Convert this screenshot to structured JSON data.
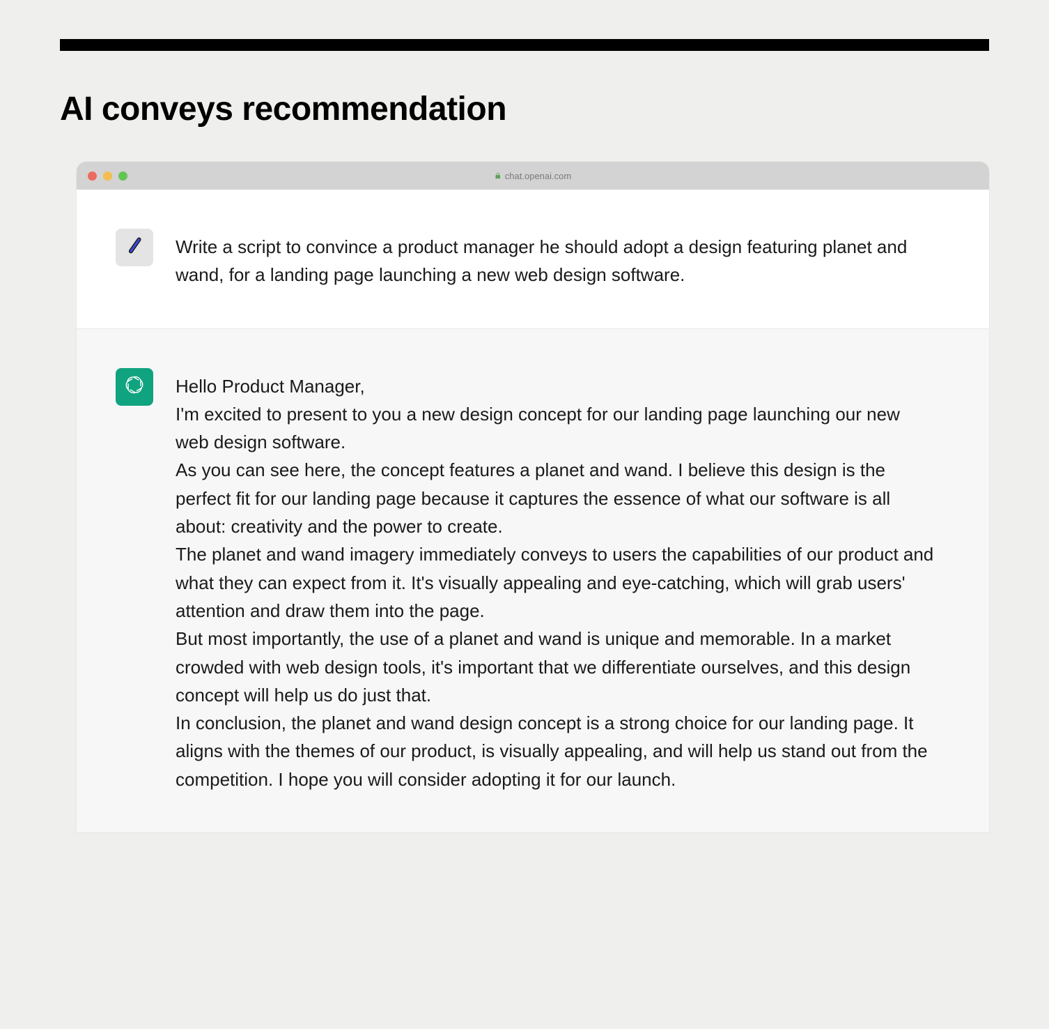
{
  "page": {
    "title": "AI conveys recommendation"
  },
  "browser": {
    "url": "chat.openai.com"
  },
  "conversation": {
    "user_message": "Write a script to convince a product manager he should adopt a design featuring planet and wand, for a landing page launching a new web design software.",
    "ai_message": {
      "p1": "Hello Product Manager,",
      "p2": "I'm excited to present to you a new design concept for our landing page launching our new web design software.",
      "p3": "As you can see here, the concept features a planet and wand. I believe this design is the perfect fit for our landing page because it captures the essence of what our software is all about: creativity and the power to create.",
      "p4": "The planet and wand imagery immediately conveys to users the capabilities of our product and what they can expect from it. It's visually appealing and eye-catching, which will grab users' attention and draw them into the page.",
      "p5": "But most importantly, the use of a planet and wand is unique and memorable. In a market crowded with web design tools, it's important that we differentiate ourselves, and this design concept will help us do just that.",
      "p6": "In conclusion, the planet and wand design concept is a strong choice for our landing page. It aligns with the themes of our product, is visually appealing, and will help us stand out from the competition. I hope you will consider adopting it for our launch."
    }
  }
}
